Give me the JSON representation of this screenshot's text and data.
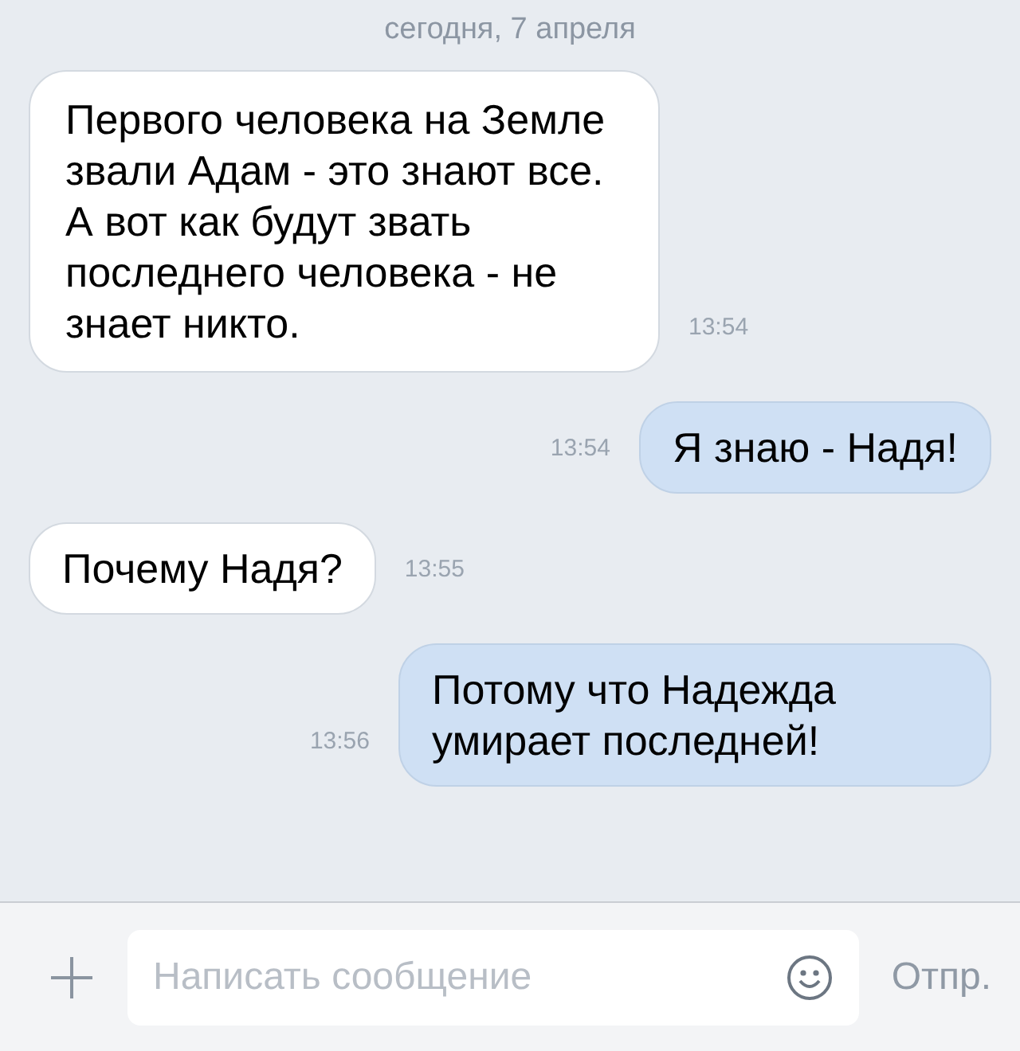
{
  "date_header": "сегодня, 7 апреля",
  "messages": [
    {
      "kind": "incoming",
      "text": "Первого человека на Земле звали Адам - это знают все. А вот как будут звать последнего человека - не знает никто.",
      "time": "13:54"
    },
    {
      "kind": "outgoing",
      "text": "Я знаю - Надя!",
      "time": "13:54"
    },
    {
      "kind": "incoming",
      "text": "Почему Надя?",
      "time": "13:55"
    },
    {
      "kind": "outgoing",
      "text": "Потому что Надежда умирает последней!",
      "time": "13:56"
    }
  ],
  "composer": {
    "placeholder": "Написать сообщение",
    "send_label": "Отпр."
  }
}
